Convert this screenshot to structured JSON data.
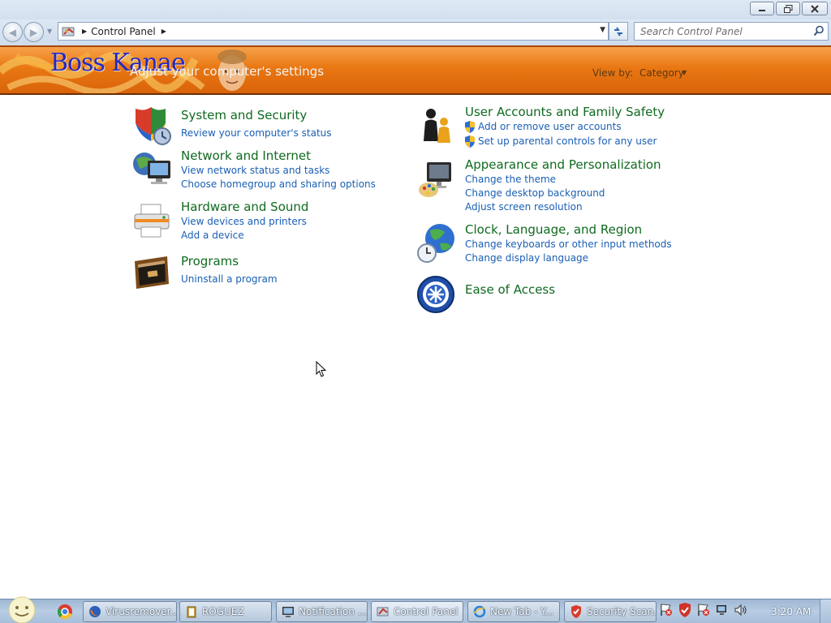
{
  "window": {
    "title": "Adjust your computer's settings",
    "minimize_icon": "minimize-icon",
    "restore_icon": "restore-icon",
    "close_icon": "close-icon"
  },
  "address_bar": {
    "path": "Control Panel",
    "search_placeholder": "Search Control Panel"
  },
  "banner": {
    "logo_text": "Boss Kanae",
    "view_by_label": "View by:",
    "view_by_value": "Category"
  },
  "categories_left": [
    {
      "title": "System and Security",
      "icon": "shield-icon",
      "links": [
        "Review your computer's status"
      ]
    },
    {
      "title": "Network and Internet",
      "icon": "network-icon",
      "links": [
        "View network status and tasks",
        "Choose homegroup and sharing options"
      ]
    },
    {
      "title": "Hardware and Sound",
      "icon": "printer-icon",
      "links": [
        "View devices and printers",
        "Add a device"
      ]
    },
    {
      "title": "Programs",
      "icon": "programs-icon",
      "links": [
        "Uninstall a program"
      ]
    }
  ],
  "categories_right": [
    {
      "title": "User Accounts and Family Safety",
      "icon": "users-icon",
      "links": [
        "Add or remove user accounts",
        "Set up parental controls for any user"
      ]
    },
    {
      "title": "Appearance and Personalization",
      "icon": "appearance-icon",
      "links": [
        "Change the theme",
        "Change desktop background",
        "Adjust screen resolution"
      ]
    },
    {
      "title": "Clock, Language, and Region",
      "icon": "globe-clock-icon",
      "links": [
        "Change keyboards or other input methods",
        "Change display language"
      ]
    },
    {
      "title": "Ease of Access",
      "icon": "ease-of-access-icon",
      "links": []
    }
  ],
  "taskbar": {
    "items": [
      {
        "label": "Virusremover...",
        "icon": "firefox-icon"
      },
      {
        "label": "ROGUEZ",
        "icon": "folder-icon"
      },
      {
        "label": "Notification ...",
        "icon": "monitor-icon"
      },
      {
        "label": "Control Panel",
        "icon": "control-panel-icon"
      },
      {
        "label": "New Tab - Y...",
        "icon": "ie-icon"
      },
      {
        "label": "Security Scan...",
        "icon": "security-icon"
      }
    ],
    "clock": "3:20 AM"
  },
  "colors": {
    "banner_orange": "#e97712",
    "category_green": "#0f6a1f",
    "link_blue": "#1a5fb4"
  }
}
